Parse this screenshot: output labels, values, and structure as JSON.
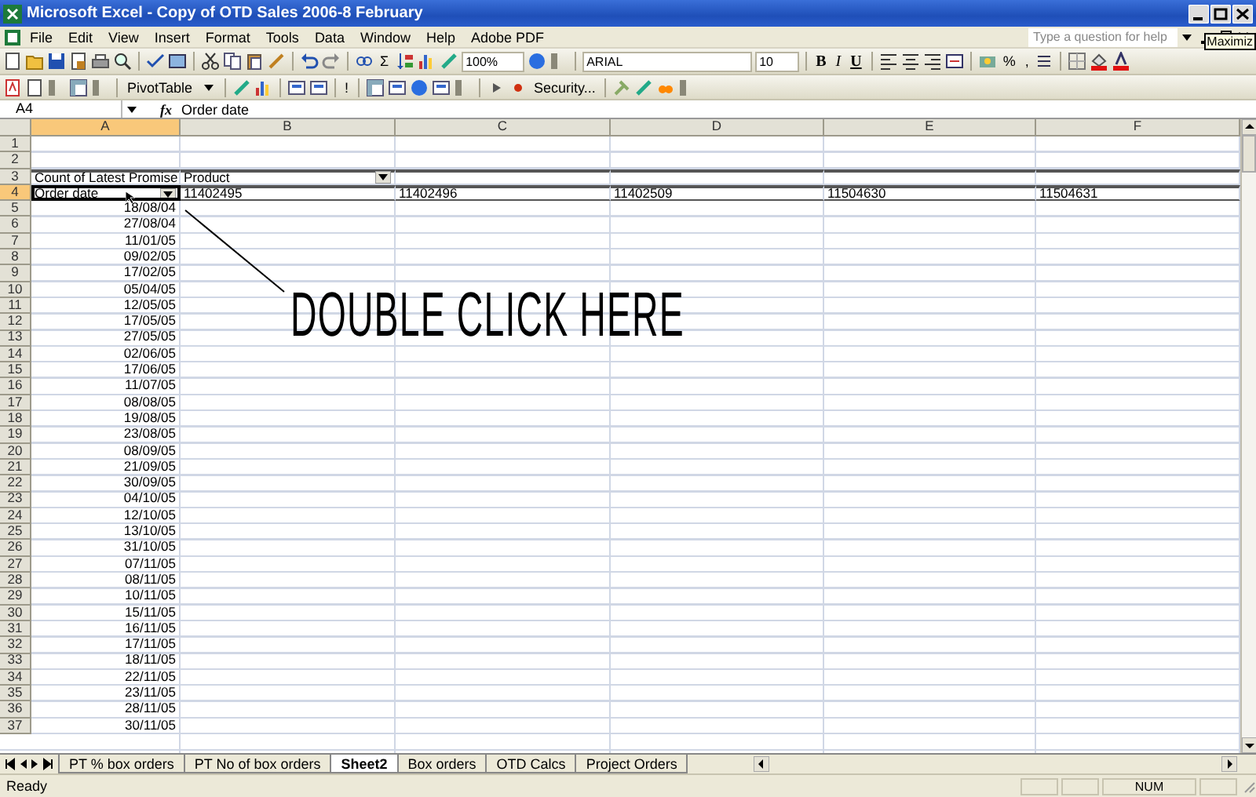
{
  "window": {
    "title": "Microsoft Excel - Copy of OTD Sales 2006-8 February"
  },
  "menu": [
    "File",
    "Edit",
    "View",
    "Insert",
    "Format",
    "Tools",
    "Data",
    "Window",
    "Help",
    "Adobe PDF"
  ],
  "help_box": {
    "placeholder": "Type a question for help"
  },
  "tooltip": "Maximiz",
  "standard_toolbar": {
    "sum": "Σ",
    "zoom": "100%"
  },
  "formatting_toolbar": {
    "font": "ARIAL",
    "size": "10",
    "bold": "B",
    "italic": "I",
    "underline": "U",
    "percent": "%",
    "comma": ","
  },
  "pivot_toolbar": {
    "pivot_menu": "PivotTable",
    "refresh": "!",
    "security": "Security..."
  },
  "formula_bar": {
    "name_box": "A4",
    "function_label": "fx",
    "formula": "Order date"
  },
  "columns": [
    {
      "label": "A",
      "selected": true
    },
    {
      "label": "B",
      "selected": false
    },
    {
      "label": "C",
      "selected": false
    },
    {
      "label": "D",
      "selected": false
    },
    {
      "label": "E",
      "selected": false
    },
    {
      "label": "F",
      "selected": false
    }
  ],
  "row_headers": [
    {
      "label": "1",
      "selected": false
    },
    {
      "label": "2",
      "selected": false
    },
    {
      "label": "3",
      "selected": false
    },
    {
      "label": "4",
      "selected": true
    },
    {
      "label": "5",
      "selected": false
    },
    {
      "label": "6",
      "selected": false
    },
    {
      "label": "7",
      "selected": false
    },
    {
      "label": "8",
      "selected": false
    },
    {
      "label": "9",
      "selected": false
    },
    {
      "label": "10",
      "selected": false
    },
    {
      "label": "11",
      "selected": false
    },
    {
      "label": "12",
      "selected": false
    },
    {
      "label": "13",
      "selected": false
    },
    {
      "label": "14",
      "selected": false
    },
    {
      "label": "15",
      "selected": false
    },
    {
      "label": "16",
      "selected": false
    },
    {
      "label": "17",
      "selected": false
    },
    {
      "label": "18",
      "selected": false
    },
    {
      "label": "19",
      "selected": false
    },
    {
      "label": "20",
      "selected": false
    },
    {
      "label": "21",
      "selected": false
    },
    {
      "label": "22",
      "selected": false
    },
    {
      "label": "23",
      "selected": false
    },
    {
      "label": "24",
      "selected": false
    },
    {
      "label": "25",
      "selected": false
    },
    {
      "label": "26",
      "selected": false
    },
    {
      "label": "27",
      "selected": false
    },
    {
      "label": "28",
      "selected": false
    },
    {
      "label": "29",
      "selected": false
    },
    {
      "label": "30",
      "selected": false
    },
    {
      "label": "31",
      "selected": false
    },
    {
      "label": "32",
      "selected": false
    },
    {
      "label": "33",
      "selected": false
    },
    {
      "label": "34",
      "selected": false
    },
    {
      "label": "35",
      "selected": false
    },
    {
      "label": "36",
      "selected": false
    },
    {
      "label": "37",
      "selected": false
    }
  ],
  "pivot": {
    "data_field": "Count of Latest Promise",
    "column_field": "Product",
    "row_field": "Order date",
    "column_items": [
      "11402495",
      "11402496",
      "11402509",
      "11504630",
      "11504631"
    ],
    "row_items": [
      "18/08/04",
      "27/08/04",
      "11/01/05",
      "09/02/05",
      "17/02/05",
      "05/04/05",
      "12/05/05",
      "17/05/05",
      "27/05/05",
      "02/06/05",
      "17/06/05",
      "11/07/05",
      "08/08/05",
      "19/08/05",
      "23/08/05",
      "08/09/05",
      "21/09/05",
      "30/09/05",
      "04/10/05",
      "12/10/05",
      "13/10/05",
      "31/10/05",
      "07/11/05",
      "08/11/05",
      "10/11/05",
      "15/11/05",
      "16/11/05",
      "17/11/05",
      "18/11/05",
      "22/11/05",
      "23/11/05",
      "28/11/05",
      "30/11/05"
    ]
  },
  "annotation": "DOUBLE CLICK HERE",
  "sheet_tabs": [
    {
      "label": "PT % box orders",
      "selected": false
    },
    {
      "label": "PT No of box orders",
      "selected": false
    },
    {
      "label": "Sheet2",
      "selected": true
    },
    {
      "label": "Box orders",
      "selected": false
    },
    {
      "label": "OTD Calcs",
      "selected": false
    },
    {
      "label": "Project Orders",
      "selected": false
    }
  ],
  "status_bar": {
    "status": "Ready",
    "indicator": "NUM"
  }
}
